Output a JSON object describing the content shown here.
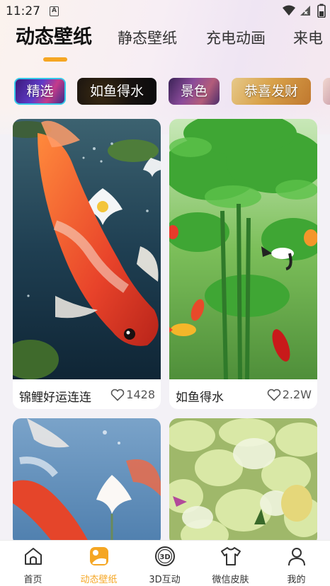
{
  "status_bar": {
    "time": "11:27",
    "sim_label": "A"
  },
  "tabs": [
    {
      "label": "动态壁纸",
      "active": true
    },
    {
      "label": "静态壁纸",
      "active": false
    },
    {
      "label": "充电动画",
      "active": false
    },
    {
      "label": "来电",
      "active": false
    }
  ],
  "chips": [
    {
      "label": "精选",
      "selected": true
    },
    {
      "label": "如鱼得水",
      "selected": false
    },
    {
      "label": "景色",
      "selected": false
    },
    {
      "label": "恭喜发财",
      "selected": false
    }
  ],
  "cards": [
    {
      "title": "锦鲤好运连连",
      "likes": "1428"
    },
    {
      "title": "如鱼得水",
      "likes": "2.2W"
    },
    {
      "title": "",
      "likes": ""
    },
    {
      "title": "",
      "likes": ""
    }
  ],
  "bottom_nav": [
    {
      "label": "首页",
      "icon": "home-icon",
      "active": false
    },
    {
      "label": "动态壁纸",
      "icon": "live-wallpaper-icon",
      "active": true
    },
    {
      "label": "3D互动",
      "icon": "3d-icon",
      "active": false
    },
    {
      "label": "微信皮肤",
      "icon": "tshirt-icon",
      "active": false
    },
    {
      "label": "我的",
      "icon": "person-icon",
      "active": false
    }
  ],
  "colors": {
    "accent": "#f5a623",
    "chip_selected_border": "#35c8e8"
  }
}
